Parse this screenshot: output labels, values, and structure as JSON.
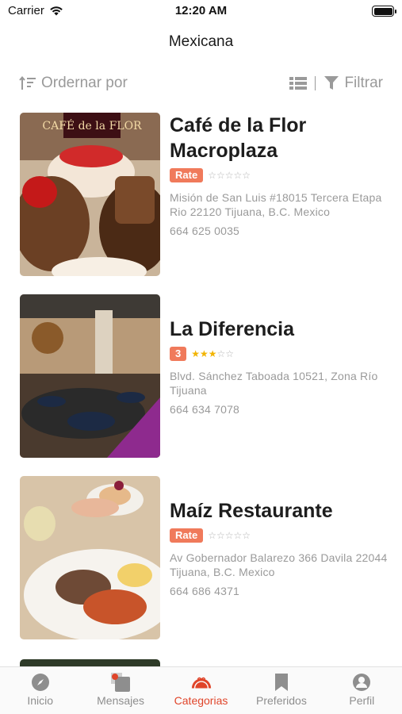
{
  "status_bar": {
    "carrier": "Carrier",
    "time": "12:20 AM"
  },
  "nav": {
    "title": "Mexicana"
  },
  "toolbar": {
    "sort_label": "Ordernar por",
    "filter_label": "Filtrar"
  },
  "restaurants": [
    {
      "name_line1": "Café de la Flor",
      "name_line2": "Macroplaza",
      "rating_badge": "Rate",
      "stars_filled": 0,
      "stars_total": 5,
      "address": "Misión de San Luis #18015 Tercera Etapa Rio 22120 Tijuana, B.C. Mexico",
      "phone": "664 625 0035",
      "thumb_label": "CAFÉ de la FLOR"
    },
    {
      "name_line1": "La Diferencia",
      "rating_badge": "3",
      "stars_filled": 3,
      "stars_total": 5,
      "address": "Blvd. Sánchez Taboada 10521, Zona Río Tijuana",
      "phone": "664 634 7078"
    },
    {
      "name_line1": "Maíz Restaurante",
      "rating_badge": "Rate",
      "stars_filled": 0,
      "stars_total": 5,
      "address": "Av Gobernador Balarezo 366 Davila 22044 Tijuana, B.C. Mexico",
      "phone": "664 686 4371"
    }
  ],
  "tabs": [
    {
      "label": "Inicio",
      "icon": "compass-icon"
    },
    {
      "label": "Mensajes",
      "icon": "messages-icon"
    },
    {
      "label": "Categorias",
      "icon": "taco-icon",
      "active": true
    },
    {
      "label": "Preferidos",
      "icon": "bookmark-icon"
    },
    {
      "label": "Perfil",
      "icon": "profile-icon"
    }
  ],
  "colors": {
    "accent": "#e0452a",
    "badge": "#f07a5b",
    "star": "#f2b400",
    "muted": "#9a9a9a"
  }
}
